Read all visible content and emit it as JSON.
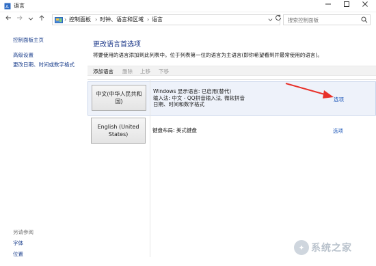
{
  "window": {
    "title": "语言",
    "icons": {
      "app": "language-icon",
      "minimize": "minimize-icon",
      "maximize": "maximize-icon",
      "close": "close-icon"
    }
  },
  "nav": {
    "back_icon": "back-arrow-icon",
    "forward_icon": "forward-arrow-icon",
    "recent_icon": "chevron-down-icon",
    "up_icon": "up-arrow-icon",
    "breadcrumb": [
      "控制面板",
      "时钟、语言和区域",
      "语言"
    ],
    "refresh_icon": "refresh-icon",
    "search_placeholder": "搜索控制面板"
  },
  "sidebar": {
    "links": [
      "控制面板主页",
      "高级设置",
      "更改日期、时间或数字格式"
    ],
    "see_also_label": "另请参阅",
    "see_also_links": [
      "字体",
      "位置"
    ]
  },
  "main": {
    "title": "更改语言首选项",
    "description": "将要使用的语言添加到此列表中。位于列表第一位的语言为主语言(即你希望看到并最常使用的语言)。",
    "toolbar": {
      "add": "添加语言",
      "remove": "删除",
      "up": "上移",
      "down": "下移"
    },
    "languages": [
      {
        "name": "中文(中华人民共和国)",
        "info": [
          "Windows 显示语言: 已启用(替代)",
          "输入法: 中文 - QQ拼音输入法, 微软拼音",
          "日期、时间和数字格式"
        ],
        "options_label": "选项"
      },
      {
        "name": "English (United States)",
        "info": [
          "键盘布局: 美式键盘"
        ],
        "options_label": "选项"
      }
    ]
  },
  "annotation": {
    "arrow_color": "#e8312a"
  },
  "watermark": {
    "text": "系统之家"
  },
  "colors": {
    "link": "#1a55b8",
    "heading": "#1e3a8a",
    "accent_arrow": "#e8312a"
  }
}
